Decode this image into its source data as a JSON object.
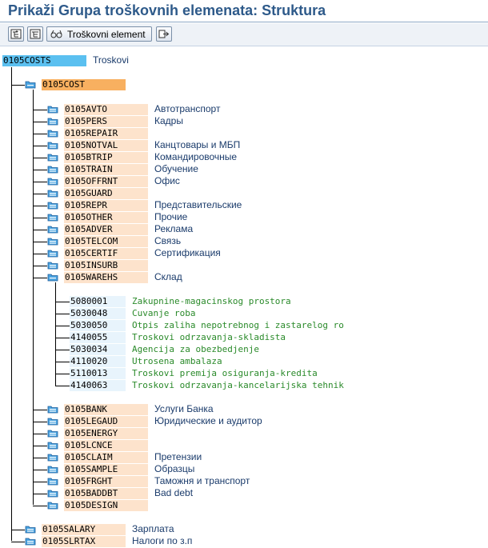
{
  "title": "Prikaži Grupa troškovnih elemenata: Struktura",
  "toolbar": {
    "buttons": [
      {
        "name": "expand-subtree-icon"
      },
      {
        "name": "collapse-subtree-icon"
      },
      {
        "name": "cost-element-button",
        "label": "Troškovni element",
        "icon": "glasses-icon"
      },
      {
        "name": "navigate-icon"
      }
    ]
  },
  "tree": {
    "root": {
      "code": "0105COSTS",
      "desc": "Troskovi"
    },
    "group": {
      "code": "0105COST"
    },
    "children": [
      {
        "code": "0105AVTO",
        "desc": "Автотранспорт"
      },
      {
        "code": "0105PERS",
        "desc": "Кадры"
      },
      {
        "code": "0105REPAIR",
        "desc": ""
      },
      {
        "code": "0105NOTVAL",
        "desc": "Канцтовары и МБП"
      },
      {
        "code": "0105BTRIP",
        "desc": "Командировочные"
      },
      {
        "code": "0105TRAIN",
        "desc": "Обучение"
      },
      {
        "code": "0105OFFRNT",
        "desc": "Офис"
      },
      {
        "code": "0105GUARD",
        "desc": ""
      },
      {
        "code": "0105REPR",
        "desc": "Представительские"
      },
      {
        "code": "0105OTHER",
        "desc": "Прочие"
      },
      {
        "code": "0105ADVER",
        "desc": "Реклама"
      },
      {
        "code": "0105TELCOM",
        "desc": "Связь"
      },
      {
        "code": "0105CERTIF",
        "desc": "Сертификация"
      },
      {
        "code": "0105INSURB",
        "desc": ""
      },
      {
        "code": "0105WAREHS",
        "desc": "Склад"
      }
    ],
    "leaves": [
      {
        "code": "5080001",
        "desc": "Zakupnine-magacinskog prostora"
      },
      {
        "code": "5030048",
        "desc": "Cuvanje roba"
      },
      {
        "code": "5030050",
        "desc": "Otpis zaliha nepotrebnog i zastarelog ro"
      },
      {
        "code": "4140055",
        "desc": "Troskovi odrzavanja-skladista"
      },
      {
        "code": "5030034",
        "desc": "Agencija za obezbedjenje"
      },
      {
        "code": "4110020",
        "desc": "Utrosena ambalaza"
      },
      {
        "code": "5110013",
        "desc": "Troskovi premija osiguranja-kredita"
      },
      {
        "code": "4140063",
        "desc": "Troskovi odrzavanja-kancelarijska tehnik"
      }
    ],
    "children2": [
      {
        "code": "0105BANK",
        "desc": "Услуги Банка"
      },
      {
        "code": "0105LEGAUD",
        "desc": "Юридические и аудитор"
      },
      {
        "code": "0105ENERGY",
        "desc": ""
      },
      {
        "code": "0105LCNCE",
        "desc": ""
      },
      {
        "code": "0105CLAIM",
        "desc": "Претензии"
      },
      {
        "code": "0105SAMPLE",
        "desc": "Образцы"
      },
      {
        "code": "0105FRGHT",
        "desc": "Таможня и транспорт"
      },
      {
        "code": "0105BADDBT",
        "desc": "Bad debt"
      },
      {
        "code": "0105DESIGN",
        "desc": ""
      }
    ],
    "siblings": [
      {
        "code": "0105SALARY",
        "desc": "Зарплата"
      },
      {
        "code": "0105SLRTAX",
        "desc": "Налоги по з.п"
      }
    ]
  },
  "colors": {
    "title": "#2e5a8a",
    "root_bg": "#5bc0f0",
    "selected_bg": "#f8b060",
    "node_bg": "#fde3cc",
    "leaf_bg": "#e8f4fc",
    "folder": "#4aa3e0",
    "desc": "#1a3b6b",
    "leaf_desc": "#2a8a2a"
  }
}
